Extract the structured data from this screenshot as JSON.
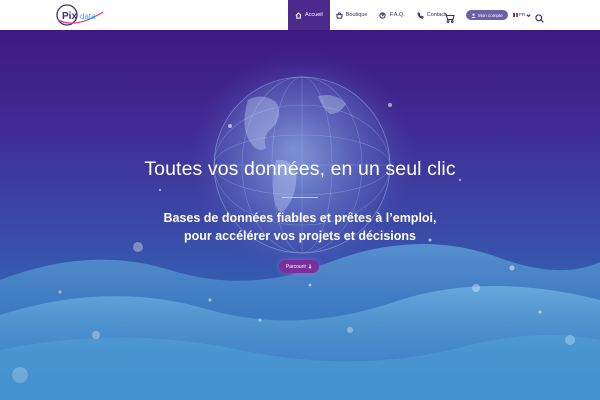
{
  "header": {
    "logo_text": "Pixdata",
    "nav": [
      {
        "label": "Accueil",
        "icon": "home-icon",
        "active": true
      },
      {
        "label": "Boutique",
        "icon": "shop-icon",
        "active": false
      },
      {
        "label": "F.A.Q.",
        "icon": "question-icon",
        "active": false
      },
      {
        "label": "Contact",
        "icon": "phone-icon",
        "active": false
      }
    ],
    "cart_icon": "cart-icon",
    "account_label": "Mon compte",
    "account_icon": "user-icon",
    "language_label": "FR",
    "search_icon": "search-icon"
  },
  "hero": {
    "title": "Toutes vos données, en un seul clic",
    "subtitle_line1": "Bases de données fiables et prêtes à l’emploi,",
    "subtitle_line2": "pour accélérer vos projets et décisions",
    "cta_label": "Parcourir",
    "cta_icon": "arrow-down-icon"
  },
  "colors": {
    "brand_purple": "#4b2a8c",
    "cta_purple": "#7b2f9c",
    "account_button": "#6c5fa8",
    "nav_text": "#3a2f6b",
    "hero_top": "#3d1a80",
    "hero_bottom": "#3b86c7"
  }
}
